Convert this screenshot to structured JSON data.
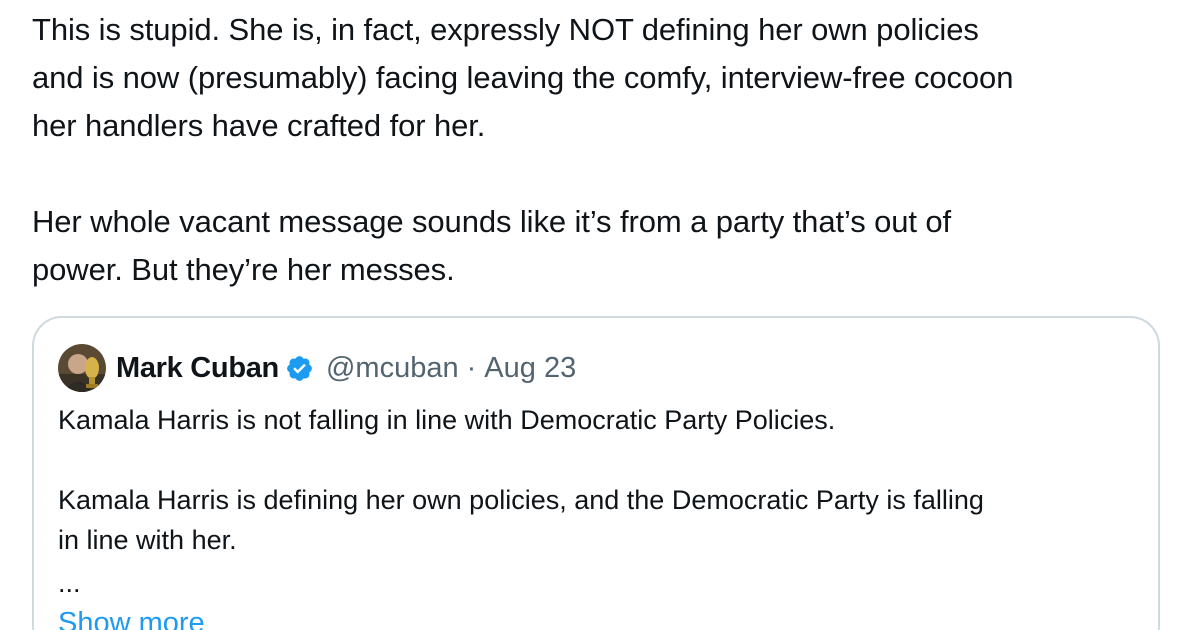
{
  "tweet": {
    "paragraph_1": "This is stupid. She is, in fact, expressly NOT defining her own policies\nand is now (presumably) facing leaving the comfy, interview-free cocoon\nher handlers have crafted for her.",
    "paragraph_2": "Her whole vacant message sounds like it’s from a party that’s out of\npower. But they’re her messes."
  },
  "quoted_tweet": {
    "author_name": "Mark Cuban",
    "verified": true,
    "handle": "@mcuban",
    "separator": "·",
    "date": "Aug 23",
    "line_1": "Kamala Harris is not falling in line with Democratic Party Policies.",
    "line_2": "Kamala Harris is defining her own policies, and the Democratic Party is falling",
    "line_3": "in line with her.",
    "ellipsis": "...",
    "show_more": "Show more"
  },
  "icons": {
    "verified": "verified-badge-icon",
    "avatar": "profile-photo"
  },
  "colors": {
    "text_primary": "#0f1419",
    "text_secondary": "#536471",
    "link": "#1d9bf0",
    "card_border": "#cfd9de",
    "verified": "#1d9bf0"
  }
}
